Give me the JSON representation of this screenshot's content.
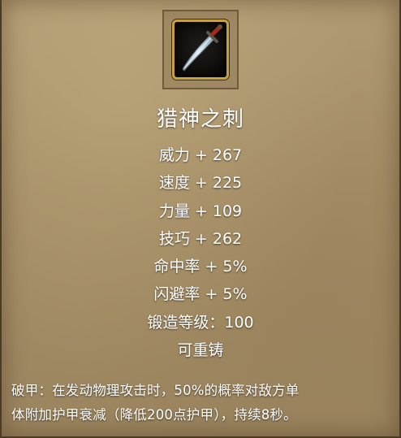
{
  "item": {
    "icon": "dagger-icon",
    "name": "猎神之刺",
    "stats": [
      "威力 + 267",
      "速度 + 225",
      "力量 + 109",
      "技巧 + 262",
      "命中率 + 5%",
      "闪避率 + 5%",
      "锻造等级：100",
      "可重铸"
    ],
    "description_lines": [
      "破甲：在发动物理攻击时，50%的概率对敌方单",
      "体附加护甲衰减（降低200点护甲），持续8秒。"
    ]
  },
  "colors": {
    "text": "#ffffff",
    "panel": "#a48d65",
    "icon_border": "#c6a23d"
  }
}
